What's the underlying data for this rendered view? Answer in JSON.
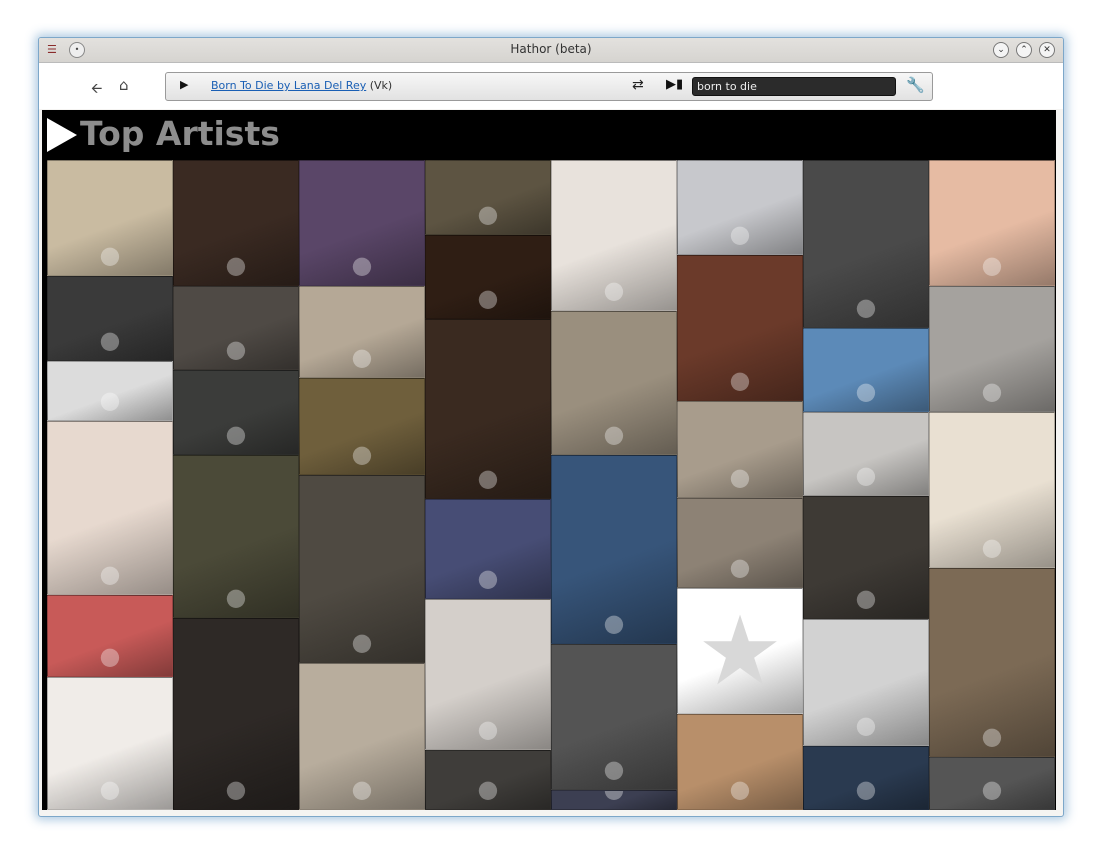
{
  "window": {
    "title": "Hathor (beta)"
  },
  "player": {
    "now_playing_link": "Born To Die by Lana Del Rey",
    "now_playing_source": "(Vk)",
    "search_value": "born to die"
  },
  "main": {
    "heading": "Top Artists"
  },
  "tiles": [
    {
      "c": "#c9bba1"
    },
    {
      "c": "#3a2a22"
    },
    {
      "c": "#5a4668"
    },
    {
      "c": "#5d5442"
    },
    {
      "c": "#e8e2dc"
    },
    {
      "c": "#c7c8cc"
    },
    {
      "c": "#4a4a4a"
    },
    {
      "c": "#e6bba3"
    },
    {
      "c": "#3a3a3a"
    },
    {
      "c": "#dcdcdc"
    },
    {
      "c": "#e7d9cf"
    },
    {
      "c": "#c85a58"
    },
    {
      "c": "#f0ece8"
    },
    {
      "c": "#4f4a45"
    },
    {
      "c": "#3b3c3a"
    },
    {
      "c": "#4b4a38"
    },
    {
      "c": "#2e2926"
    },
    {
      "c": "#b5a896"
    },
    {
      "c": "#6f5f3c"
    },
    {
      "c": "#4f4a42"
    },
    {
      "c": "#b8ad9d"
    },
    {
      "c": "#2f1e14"
    },
    {
      "c": "#3a2a20"
    },
    {
      "c": "#474d75"
    },
    {
      "c": "#d4cfca"
    },
    {
      "c": "#3f3d3a"
    },
    {
      "c": "#9a8f7e"
    },
    {
      "c": "#37557a"
    },
    {
      "c": "#545454"
    },
    {
      "c": "#3c3f52"
    },
    {
      "c": "#6b3a2a"
    },
    {
      "c": "#a89c8c"
    },
    {
      "c": "#8d8275"
    },
    {
      "c": "#ffffff"
    },
    {
      "c": "#b88f6a"
    },
    {
      "c": "#5c8ab8"
    },
    {
      "c": "#c7c5c2"
    },
    {
      "c": "#3e3a35"
    },
    {
      "c": "#d2d2d2"
    },
    {
      "c": "#2a3a50"
    },
    {
      "c": "#a5a29e"
    },
    {
      "c": "#e9e0d2"
    },
    {
      "c": "#7c6a55"
    }
  ]
}
